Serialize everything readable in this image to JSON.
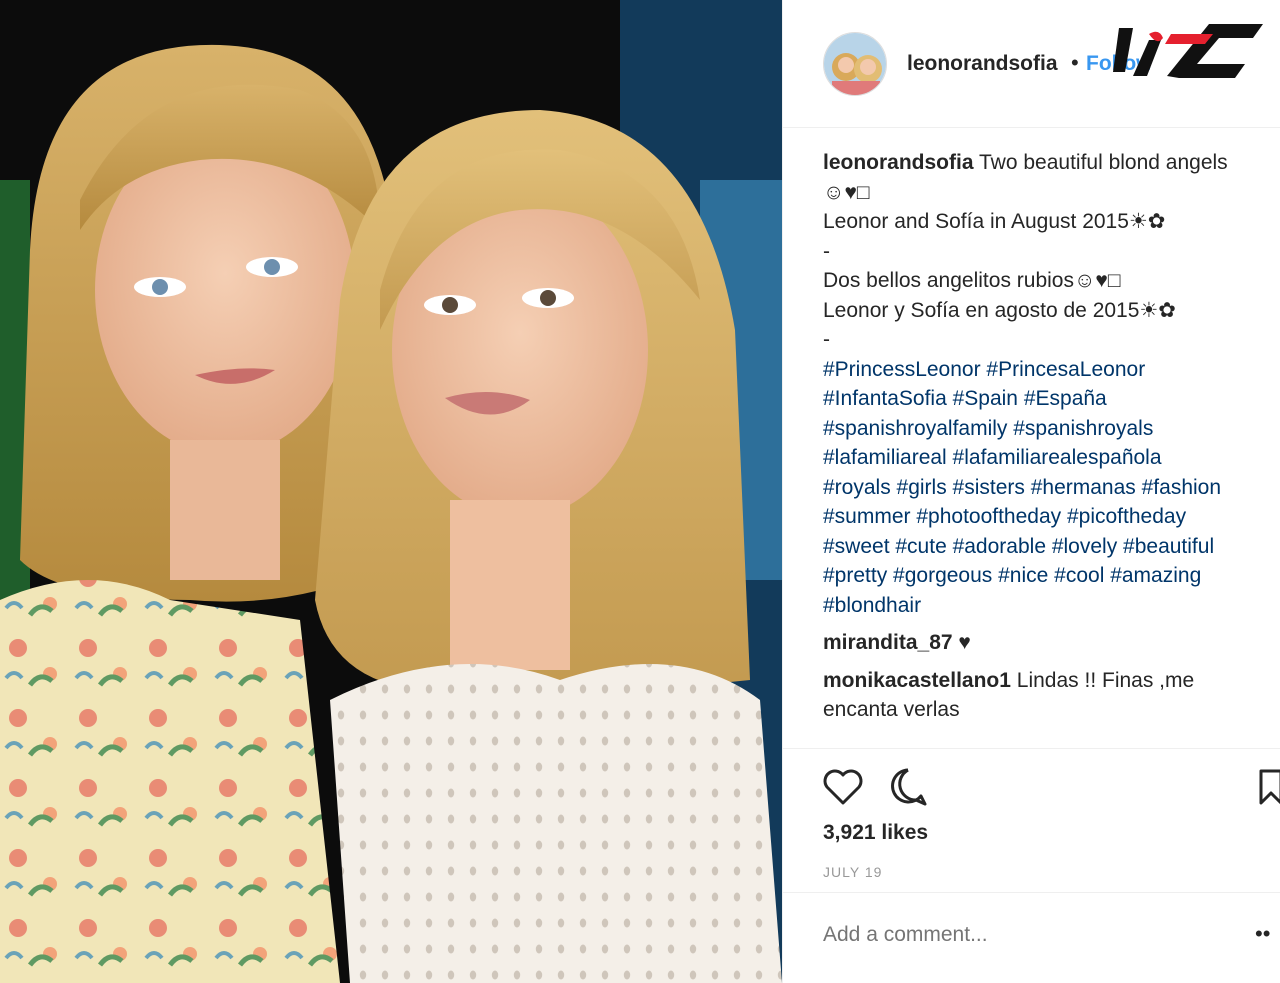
{
  "post": {
    "username": "leonorandsofia",
    "follow_label": "Follow",
    "separator": "•",
    "caption_lines": [
      "Two beautiful blond angels",
      "☺♥□",
      "Leonor and Sofía in August 2015☀✿",
      "-",
      "Dos bellos angelitos rubios☺♥□",
      "Leonor y Sofía en agosto de 2015☀✿",
      "-"
    ],
    "hashtag_lines": [
      "#PrincessLeonor #PrincesaLeonor",
      "#InfantaSofia #Spain #España",
      "#spanishroyalfamily #spanishroyals",
      "#lafamiliareal #lafamiliarealespañola",
      "#royals #girls #sisters #hermanas #fashion",
      "#summer #photooftheday #picoftheday",
      "#sweet #cute #adorable #lovely #beautiful",
      "#pretty #gorgeous #nice #cool #amazing",
      "#blondhair"
    ],
    "comments": [
      {
        "user": "mirandita_87",
        "text": "♥"
      },
      {
        "user": "monikacastellano1",
        "text": "Lindas !! Finas ,me encanta verlas"
      }
    ],
    "likes": "3,921 likes",
    "date": "JULY 19",
    "add_comment_placeholder": "Add a comment...",
    "more_label": "••"
  },
  "icons": {
    "like": "heart-icon",
    "comment": "comment-icon",
    "save": "bookmark-icon",
    "more": "more-options-icon"
  },
  "colors": {
    "link": "#3897f0",
    "hashtag": "#003569",
    "muted": "#999999",
    "logo_red": "#e5202e"
  }
}
